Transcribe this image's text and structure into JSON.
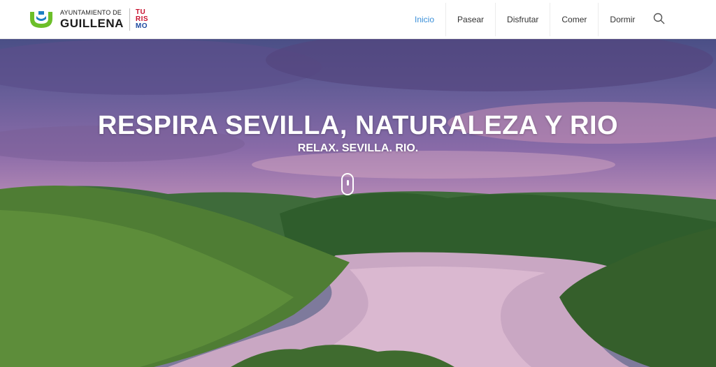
{
  "header": {
    "logo": {
      "small_text": "AYUNTAMIENTO DE",
      "big_text": "GUILLENA",
      "turismo_line1": "TU",
      "turismo_line2": "RIS",
      "turismo_line3": "MO"
    },
    "nav": {
      "items": [
        {
          "label": "Inicio",
          "active": true
        },
        {
          "label": "Pasear",
          "active": false
        },
        {
          "label": "Disfrutar",
          "active": false
        },
        {
          "label": "Comer",
          "active": false
        },
        {
          "label": "Dormir",
          "active": false
        }
      ],
      "active_color": "#3a8fd8"
    },
    "search_icon": "search-icon"
  },
  "hero": {
    "title": "RESPIRA SEVILLA, NATURALEZA Y RIO",
    "subtitle": "RELAX. SEVILLA. RIO.",
    "scroll_icon": "mouse-scroll-icon"
  }
}
